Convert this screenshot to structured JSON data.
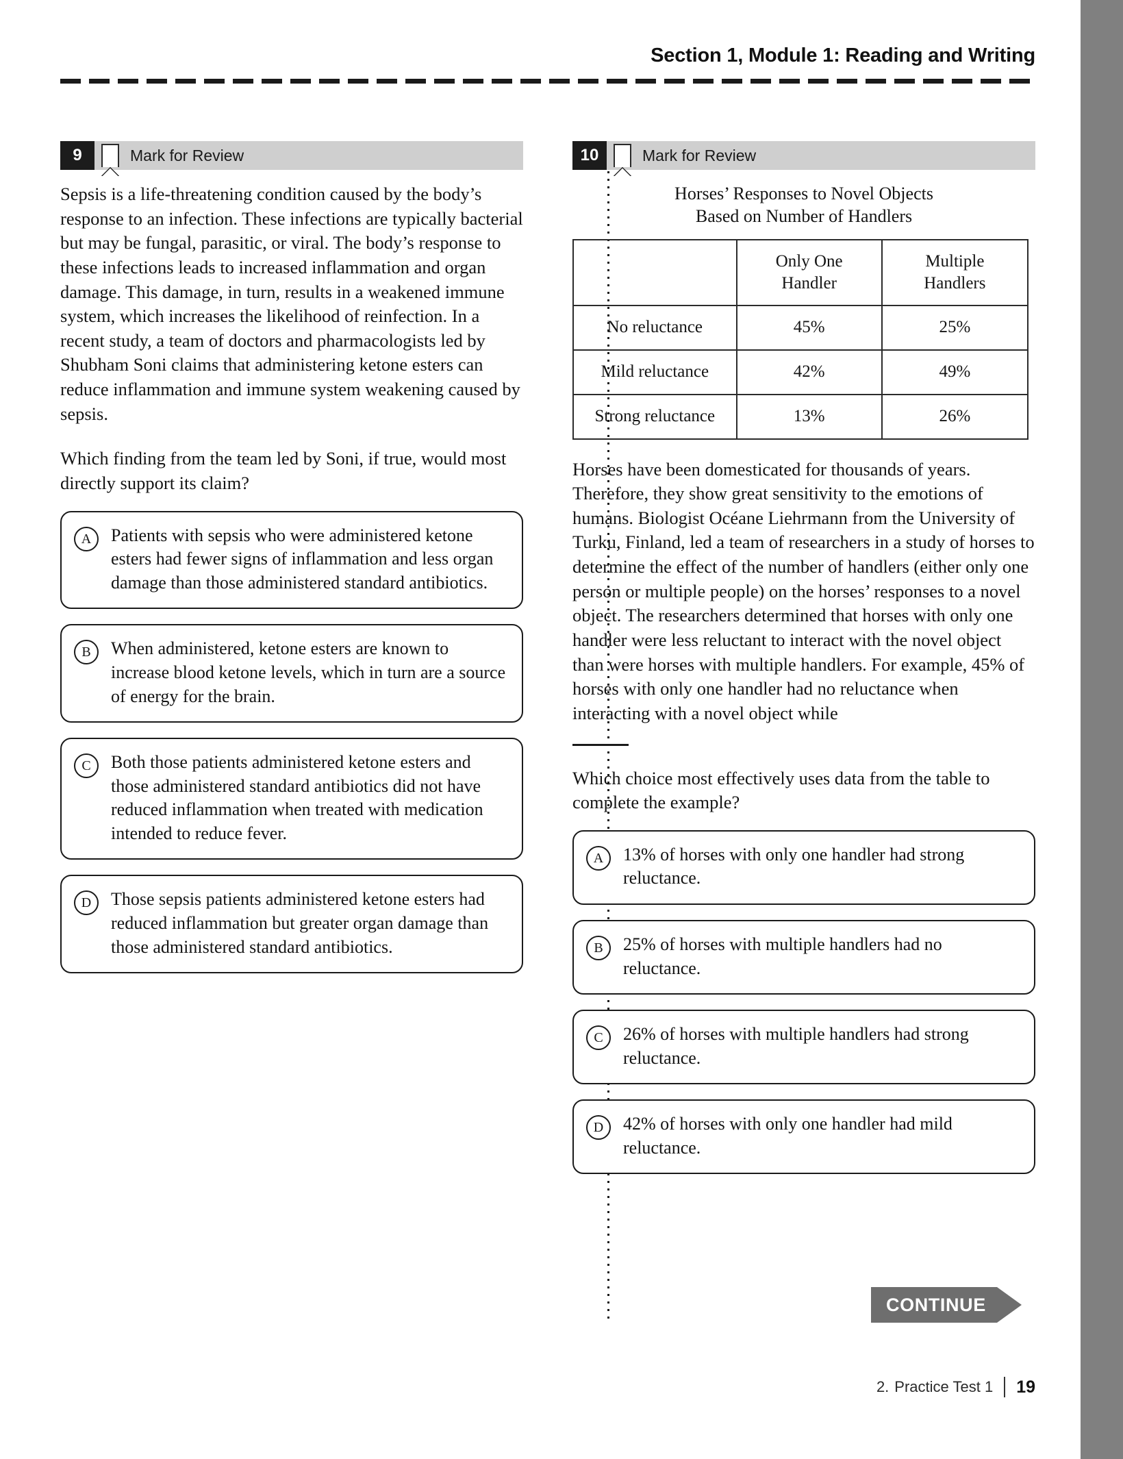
{
  "header": {
    "title": "Section 1, Module 1: Reading and Writing"
  },
  "questions": [
    {
      "number": "9",
      "mark_label": "Mark for Review",
      "passage": "Sepsis is a life-threatening condition caused by the body’s response to an infection. These infections are typically bacterial but may be fungal, parasitic, or viral. The body’s response to these infections leads to increased inflammation and organ damage. This damage, in turn, results in a weakened immune system, which increases the likelihood of reinfection. In a recent study, a team of doctors and pharmacologists led by Shubham Soni claims that administering ketone esters can reduce inflammation and immune system weakening caused by sepsis.",
      "stem": "Which finding from the team led by Soni, if true, would most directly support its claim?",
      "choices": [
        {
          "letter": "A",
          "text": "Patients with sepsis who were administered ketone esters had fewer signs of inflammation and less organ damage than those administered standard antibiotics."
        },
        {
          "letter": "B",
          "text": "When administered, ketone esters are known to increase blood ketone levels, which in turn are a source of energy for the brain."
        },
        {
          "letter": "C",
          "text": "Both those patients administered ketone esters and those administered standard antibiotics did not have reduced inflammation when treated with medication intended to reduce fever."
        },
        {
          "letter": "D",
          "text": "Those sepsis patients administered ketone esters had reduced inflammation but greater organ damage than those administered standard antibiotics."
        }
      ]
    },
    {
      "number": "10",
      "mark_label": "Mark for Review",
      "table_title_line1": "Horses’ Responses to Novel Objects",
      "table_title_line2": "Based on Number of Handlers",
      "passage": "Horses have been domesticated for thousands of years. Therefore, they show great sensitivity to the emotions of humans. Biologist Océane Liehrmann from the University of Turku, Finland, led a team of researchers in a study of horses to determine the effect of the number of handlers (either only one person or multiple people) on the horses’ responses to a novel object. The researchers determined that horses with only one handler were less reluctant to interact with the novel object than were horses with multiple handlers. For example, 45% of horses with only one handler had no reluctance when interacting with a novel object while",
      "stem": "Which choice most effectively uses data from the table to complete the example?",
      "choices": [
        {
          "letter": "A",
          "text": "13% of horses with only one handler had strong reluctance."
        },
        {
          "letter": "B",
          "text": "25% of horses with multiple handlers had no reluctance."
        },
        {
          "letter": "C",
          "text": "26% of horses with multiple handlers had strong reluctance."
        },
        {
          "letter": "D",
          "text": "42% of horses with only one handler had mild reluctance."
        }
      ]
    }
  ],
  "chart_data": {
    "type": "table",
    "title": "Horses’ Responses to Novel Objects Based on Number of Handlers",
    "corner_header": "",
    "columns": [
      "Only One Handler",
      "Multiple Handlers"
    ],
    "column_lines": [
      [
        "Only One",
        "Handler"
      ],
      [
        "Multiple",
        "Handlers"
      ]
    ],
    "categories": [
      "No reluctance",
      "Mild reluctance",
      "Strong reluctance"
    ],
    "rows": [
      {
        "label": "No reluctance",
        "values": [
          "45%",
          "25%"
        ]
      },
      {
        "label": "Mild reluctance",
        "values": [
          "42%",
          "49%"
        ]
      },
      {
        "label": "Strong reluctance",
        "values": [
          "13%",
          "26%"
        ]
      }
    ],
    "series": [
      {
        "name": "Only One Handler",
        "values": [
          45,
          42,
          13
        ]
      },
      {
        "name": "Multiple Handlers",
        "values": [
          25,
          49,
          26
        ]
      }
    ],
    "units": "percent"
  },
  "continue_button": {
    "label": "CONTINUE"
  },
  "footer": {
    "chapter": "2.",
    "label": "Practice Test 1",
    "page": "19"
  },
  "colors": {
    "banner_bg": "#cfcfcf",
    "number_bg": "#1c1c1c",
    "continue_bg": "#6e6e6e",
    "edge_bar": "#808080"
  }
}
